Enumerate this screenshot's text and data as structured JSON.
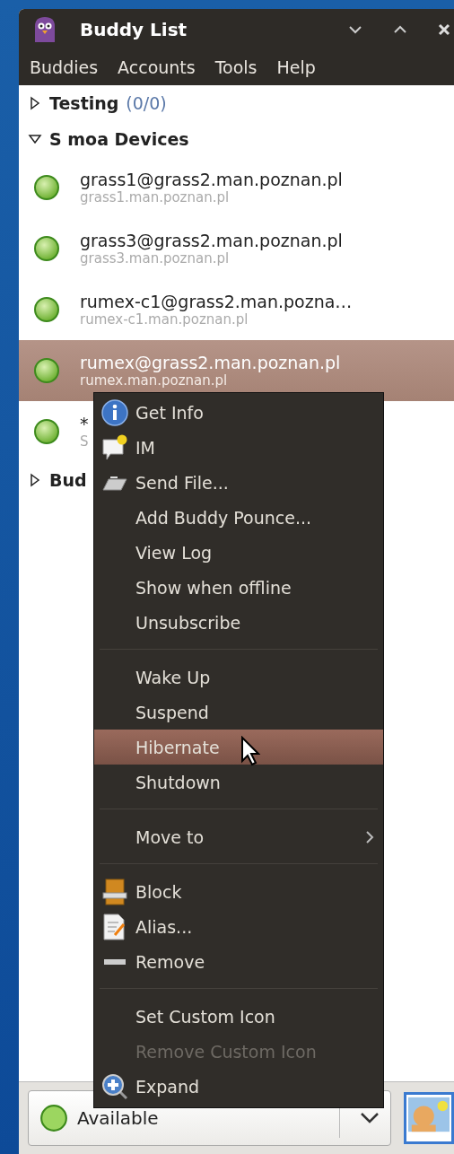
{
  "window": {
    "title": "Buddy List"
  },
  "menubar": [
    "Buddies",
    "Accounts",
    "Tools",
    "Help"
  ],
  "groups": [
    {
      "name": "Testing",
      "count": "(0/0)",
      "expanded": false
    },
    {
      "name": "S moa Devices",
      "expanded": true,
      "buddies": [
        {
          "name": "grass1@grass2.man.poznan.pl",
          "status": "grass1.man.poznan.pl",
          "selected": false
        },
        {
          "name": "grass3@grass2.man.poznan.pl",
          "status": "grass3.man.poznan.pl",
          "selected": false
        },
        {
          "name": "rumex-c1@grass2.man.pozna…",
          "status": "rumex-c1.man.poznan.pl",
          "selected": false
        },
        {
          "name": "rumex@grass2.man.poznan.pl",
          "status": "rumex.man.poznan.pl",
          "selected": true
        },
        {
          "name": "*",
          "status": "S",
          "selected": false
        }
      ]
    },
    {
      "name": "Bud",
      "expanded": false
    }
  ],
  "context_menu": [
    {
      "kind": "item",
      "label": "Get Info",
      "selected": false,
      "disabled": false
    },
    {
      "kind": "item",
      "label": "IM",
      "selected": false,
      "disabled": false
    },
    {
      "kind": "item",
      "label": "Send File...",
      "selected": false,
      "disabled": false
    },
    {
      "kind": "item",
      "label": "Add Buddy Pounce...",
      "selected": false,
      "disabled": false
    },
    {
      "kind": "item",
      "label": "View Log",
      "selected": false,
      "disabled": false
    },
    {
      "kind": "item",
      "label": "Show when offline",
      "selected": false,
      "disabled": false
    },
    {
      "kind": "item",
      "label": "Unsubscribe",
      "selected": false,
      "disabled": false
    },
    {
      "kind": "separator"
    },
    {
      "kind": "item",
      "label": "Wake Up",
      "selected": false,
      "disabled": false
    },
    {
      "kind": "item",
      "label": "Suspend",
      "selected": false,
      "disabled": false
    },
    {
      "kind": "item",
      "label": "Hibernate",
      "selected": true,
      "disabled": false
    },
    {
      "kind": "item",
      "label": "Shutdown",
      "selected": false,
      "disabled": false
    },
    {
      "kind": "separator"
    },
    {
      "kind": "submenu",
      "label": "Move to",
      "selected": false,
      "disabled": false
    },
    {
      "kind": "separator"
    },
    {
      "kind": "item",
      "label": "Block",
      "selected": false,
      "disabled": false
    },
    {
      "kind": "item",
      "label": "Alias...",
      "selected": false,
      "disabled": false
    },
    {
      "kind": "item",
      "label": "Remove",
      "selected": false,
      "disabled": false
    },
    {
      "kind": "separator"
    },
    {
      "kind": "item",
      "label": "Set Custom Icon",
      "selected": false,
      "disabled": false
    },
    {
      "kind": "item",
      "label": "Remove Custom Icon",
      "selected": false,
      "disabled": true
    },
    {
      "kind": "item",
      "label": "Expand",
      "selected": false,
      "disabled": false
    }
  ],
  "status": {
    "label": "Available"
  }
}
